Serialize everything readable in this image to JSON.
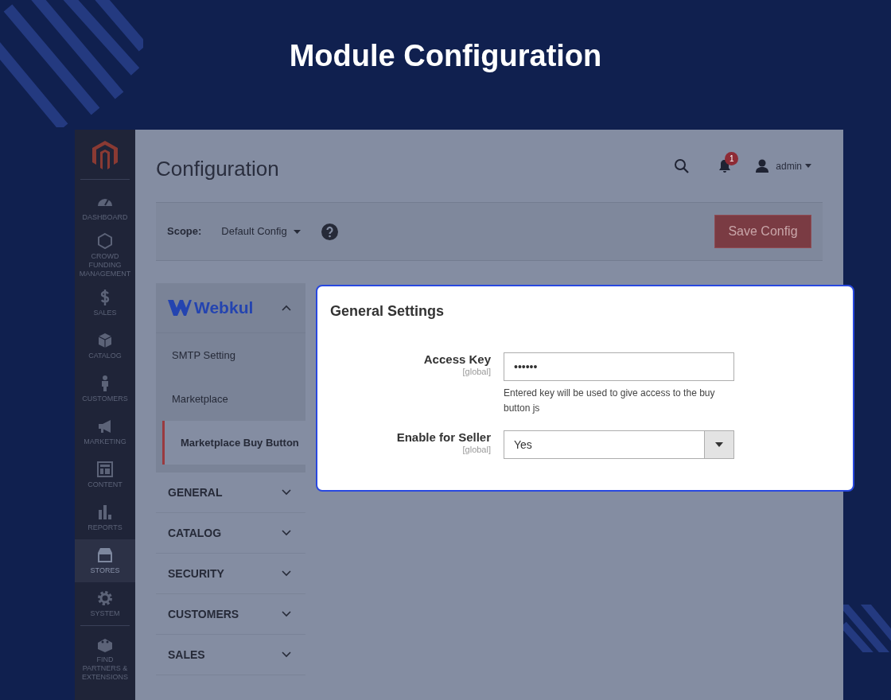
{
  "title": "Module Configuration",
  "sidebar": {
    "items": [
      {
        "label": "DASHBOARD",
        "kind": "gauge",
        "selected": false
      },
      {
        "label": "CROWD FUNDING MANAGEMENT",
        "kind": "hexagon",
        "selected": false
      },
      {
        "label": "SALES",
        "kind": "dollar",
        "selected": false
      },
      {
        "label": "CATALOG",
        "kind": "box",
        "selected": false
      },
      {
        "label": "CUSTOMERS",
        "kind": "person",
        "selected": false
      },
      {
        "label": "MARKETING",
        "kind": "megaphone",
        "selected": false
      },
      {
        "label": "CONTENT",
        "kind": "layout",
        "selected": false
      },
      {
        "label": "REPORTS",
        "kind": "bars",
        "selected": false
      },
      {
        "label": "STORES",
        "kind": "store",
        "selected": true
      },
      {
        "label": "SYSTEM",
        "kind": "gear",
        "selected": false
      },
      {
        "label": "FIND PARTNERS & EXTENSIONS",
        "kind": "bricks",
        "selected": false
      }
    ]
  },
  "header": {
    "title": "Configuration",
    "notifications": "1",
    "user": "admin"
  },
  "scope": {
    "label": "Scope:",
    "value": "Default Config"
  },
  "save_button": "Save Config",
  "nav": {
    "group": {
      "label": "Webkul",
      "expanded": true,
      "children": [
        {
          "label": "SMTP Setting",
          "selected": false
        },
        {
          "label": "Marketplace",
          "selected": false
        },
        {
          "label": "Marketplace Buy Button",
          "selected": true
        }
      ]
    },
    "sections": [
      {
        "label": "GENERAL",
        "expanded": false
      },
      {
        "label": "CATALOG",
        "expanded": false
      },
      {
        "label": "SECURITY",
        "expanded": false
      },
      {
        "label": "CUSTOMERS",
        "expanded": false
      },
      {
        "label": "SALES",
        "expanded": false
      }
    ]
  },
  "settings": {
    "title": "General Settings",
    "fields": [
      {
        "kind": "password",
        "label": "Access Key",
        "scope": "[global]",
        "value": "••••••",
        "note": "Entered key will be used to give access to the buy button js"
      },
      {
        "kind": "select",
        "label": "Enable for Seller",
        "scope": "[global]",
        "value": "Yes"
      }
    ]
  }
}
